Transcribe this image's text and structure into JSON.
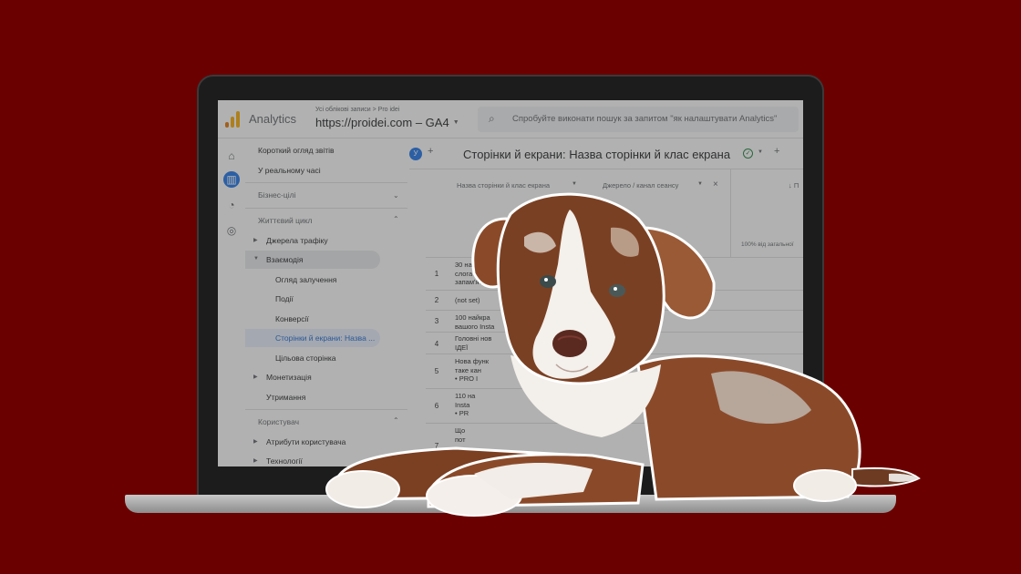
{
  "header": {
    "app_name": "Analytics",
    "breadcrumb": "Усі облікові записи > Pro idei",
    "property": "https://proidei.com – GA4",
    "search_placeholder": "Спробуйте виконати пошук за запитом \"як налаштувати Analytics\""
  },
  "nav": {
    "items": [
      {
        "label": "Короткий огляд звітів"
      },
      {
        "label": "У реальному часі"
      },
      {
        "label": "Бізнес-цілі"
      },
      {
        "label": "Життєвий цикл"
      },
      {
        "label": "Джерела трафіку"
      },
      {
        "label": "Взаємодія"
      },
      {
        "label": "Огляд залучення"
      },
      {
        "label": "Події"
      },
      {
        "label": "Конверсії"
      },
      {
        "label": "Сторінки й екрани: Назва ..."
      },
      {
        "label": "Цільова сторінка"
      },
      {
        "label": "Монетизація"
      },
      {
        "label": "Утримання"
      },
      {
        "label": "Користувач"
      },
      {
        "label": "Атрибути користувача"
      },
      {
        "label": "Технології"
      }
    ]
  },
  "report": {
    "chip": "У",
    "title": "Сторінки й екрани: Назва сторінки й клас екрана",
    "columns": [
      "Назва сторінки й клас екрана",
      "Джерело / канал сеансу"
    ],
    "sort_label": "↓ П",
    "percent_note": "100% від загальної"
  },
  "table": {
    "rows": [
      {
        "num": "1",
        "text": "30 на\nслога\nзапам'ята"
      },
      {
        "num": "2",
        "text": "(not set)"
      },
      {
        "num": "3",
        "text": "100 найкра\nвашого Insta"
      },
      {
        "num": "4",
        "text": "Головні нов\nІДЕЇ"
      },
      {
        "num": "5",
        "text": "Нова функ\nтаке кан\n• PRO І"
      },
      {
        "num": "6",
        "text": "110 на\nInsta\n• PR"
      },
      {
        "num": "7",
        "text": "Що\nпот"
      }
    ]
  },
  "colors": {
    "background": "#6b0000",
    "accent": "#1a73e8",
    "logo_orange": "#f9ab00",
    "logo_dark": "#e37400"
  }
}
